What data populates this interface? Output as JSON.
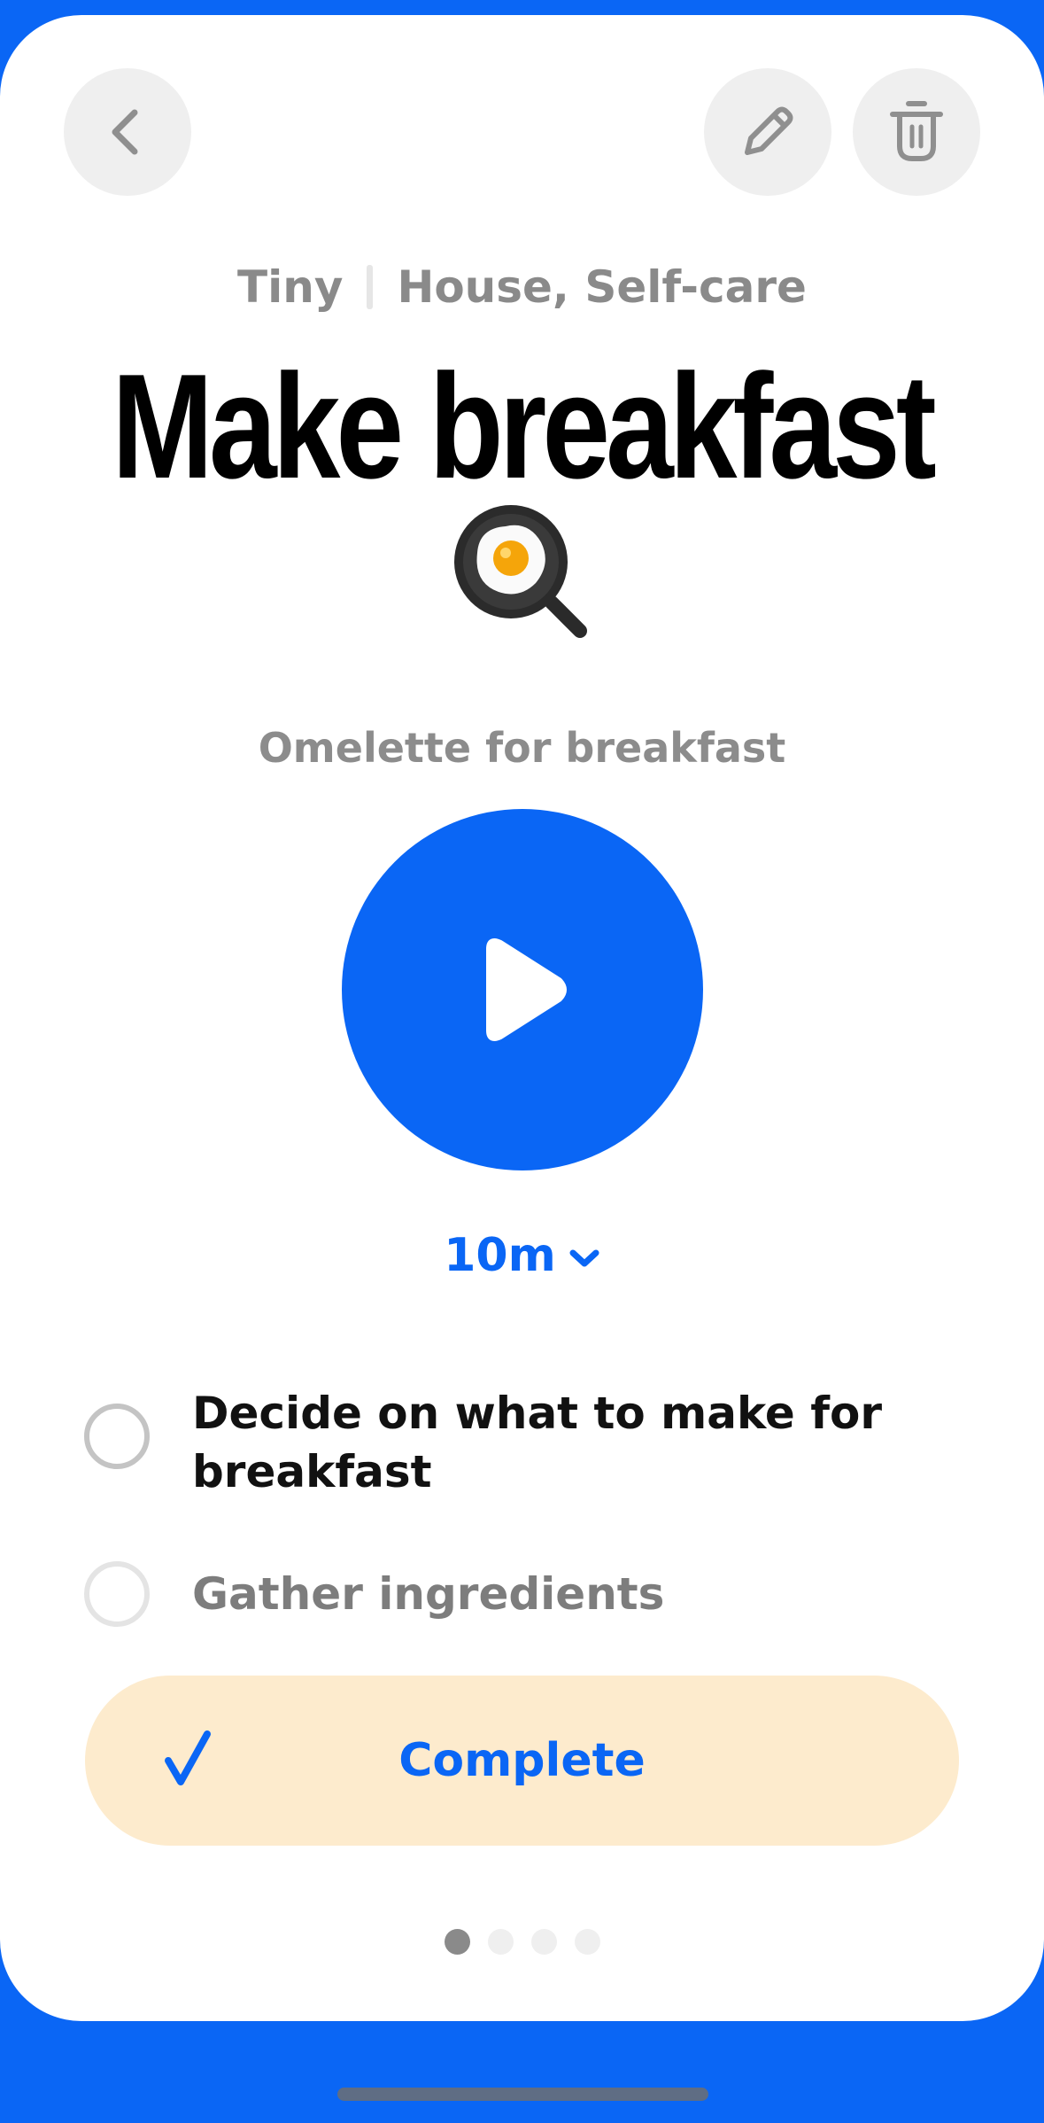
{
  "header": {
    "back_icon": "chevron-left-icon",
    "edit_icon": "pencil-icon",
    "delete_icon": "trash-icon"
  },
  "task": {
    "size": "Tiny",
    "categories": "House, Self-care",
    "title": "Make breakfast",
    "emoji": "fried-egg-pan-icon",
    "description": "Omelette for breakfast",
    "duration": "10m"
  },
  "steps": [
    {
      "label": "Decide on what to make for breakfast",
      "checked": false
    },
    {
      "label": "Gather ingredients",
      "checked": false
    }
  ],
  "actions": {
    "complete_label": "Complete"
  },
  "pager": {
    "total": 4,
    "active_index": 0
  },
  "colors": {
    "accent": "#0a66f5",
    "complete_bg": "#fdebcd",
    "muted_text": "#8a8a8a"
  }
}
